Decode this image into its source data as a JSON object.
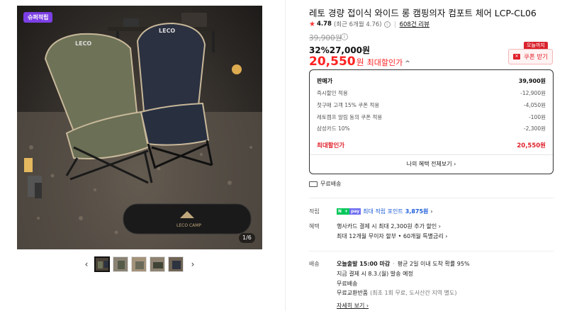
{
  "gallery": {
    "badge": "슈퍼적립",
    "counter": "1/6",
    "prev_arrow": "‹",
    "next_arrow": "›",
    "photo_logo": "LECO CAMP",
    "thumbnail_count": 5
  },
  "product": {
    "title": "레토 경량 접이식 와이드 롱 캠핑의자 컴포트 체어 LCP-CL06",
    "rating": "4.78",
    "rating_sub": "(최근 6개월 4.76)",
    "reviews": "608건 리뷰",
    "original_price": "39,900원",
    "sale_line": "32%27,000원",
    "max_discount_price": "20,550",
    "max_discount_won": "원",
    "max_discount_label": "최대할인가",
    "max_discount_chevron": "^"
  },
  "coupon": {
    "today_badge": "오늘까지",
    "button_label": "쿠폰 받기"
  },
  "benefit_box": {
    "rows": [
      {
        "label": "판매가",
        "value": "39,900원"
      },
      {
        "label": "즉시할인 적용",
        "value": "-12,900원"
      },
      {
        "label": "첫구매 고객 15% 쿠폰 적용",
        "value": "-4,050원"
      },
      {
        "label": "레토캠프 알림 동의 쿠폰 적용",
        "value": "-100원"
      },
      {
        "label": "삼성카드 10%",
        "value": "-2,300원"
      }
    ],
    "max_label": "최대할인가",
    "max_value": "20,550원",
    "all_benefits": "나의 혜택 전체보기 ›"
  },
  "shipping": {
    "label": "무료배송"
  },
  "points": {
    "section_label": "적립",
    "np_badge_1": "N",
    "np_badge_2": "+",
    "np_badge_3": "pay",
    "text_prefix": "최대 적립 포인트 ",
    "amount": "3,875원",
    "chevron": "›"
  },
  "card_benefit": {
    "section_label": "혜택",
    "line1": "행사카드 결제 시 최대 2,300원 추가 할인 ›",
    "line2": "최대 12개월 무이자 할부 • 60개월 특별금리 ›"
  },
  "delivery": {
    "section_label": "배송",
    "today_ship": "오늘출발 15:00 마감",
    "today_ship_detail": "평균 2일 이내 도착 확률 95%",
    "pay_now": "지금 결제 시 8.3.(월) 발송 예정",
    "free_ship": "무료배송",
    "free_return": "무료교환반품",
    "free_return_detail": "(최초 1회 무료, 도서산간 지역 별도)",
    "detail_link": "자세히 보기 ›"
  },
  "colors": {
    "accent_red": "#e0202a",
    "badge_purple": "#7B3FE4",
    "points_blue": "#1c5bd8"
  }
}
